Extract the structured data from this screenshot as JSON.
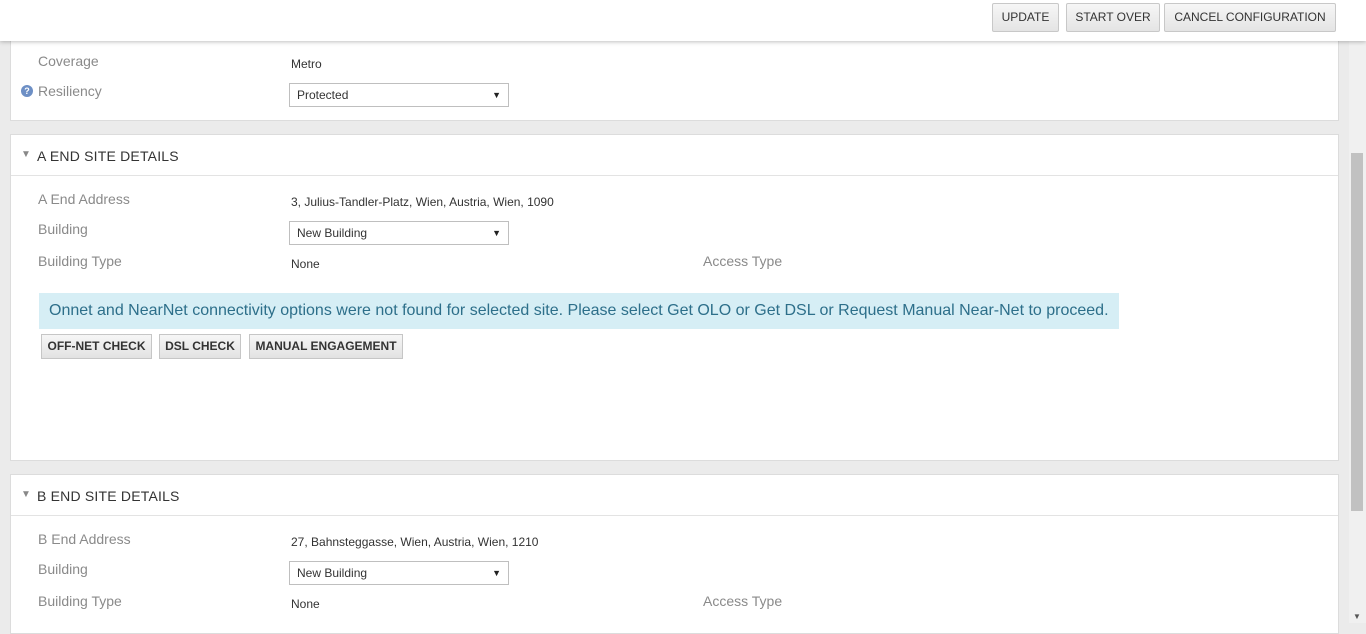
{
  "toolbar": {
    "update": "UPDATE",
    "start_over": "START OVER",
    "cancel": "CANCEL CONFIGURATION"
  },
  "service": {
    "coverage_label": "Coverage",
    "coverage_value": "Metro",
    "resiliency_label": "Resiliency",
    "resiliency_value": "Protected",
    "help_glyph": "?"
  },
  "a_end": {
    "caret": "▼",
    "title": "A END SITE DETAILS",
    "address_label": "A End Address",
    "address_value": "3, Julius-Tandler-Platz, Wien, Austria, Wien, 1090",
    "building_label": "Building",
    "building_value": "New Building",
    "building_type_label": "Building Type",
    "building_type_value": "None",
    "access_type_label": "Access Type",
    "alert": "Onnet and NearNet connectivity options were not found for selected site. Please select Get OLO or Get DSL or Request Manual Near-Net to proceed.",
    "offnet_check": "OFF-NET CHECK",
    "dsl_check": "DSL CHECK",
    "manual_engagement": "MANUAL ENGAGEMENT"
  },
  "b_end": {
    "caret": "▼",
    "title": "B END SITE DETAILS",
    "address_label": "B End Address",
    "address_value": "27, Bahnsteggasse, Wien, Austria, Wien, 1210",
    "building_label": "Building",
    "building_value": "New Building",
    "building_type_label": "Building Type",
    "building_type_value": "None",
    "access_type_label": "Access Type"
  },
  "select_arrow": "▼",
  "scroll_arrow": "▼"
}
